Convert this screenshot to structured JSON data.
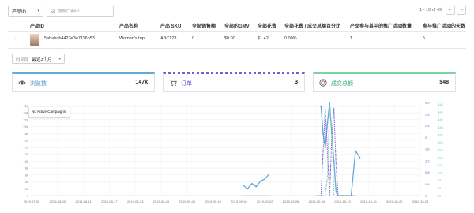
{
  "toolbar": {
    "select_label": "产品ID",
    "search_placeholder": "搜索产品ID",
    "pager_text": "1 - 10 of 49"
  },
  "table": {
    "columns": [
      "产品ID",
      "产品名称",
      "产品 SKU",
      "全部销售额",
      "全部的GMV",
      "全部花费",
      "全部花费 / 成交总额百分比",
      "产品参与其中的推广活动数量",
      "参与推广活动的天数"
    ],
    "row": [
      "5ababab4423e3e7116b53...",
      "Woman's top",
      "ABC123",
      "0",
      "$0.00",
      "$1.42",
      "0.00%",
      "1",
      "5"
    ]
  },
  "date_range": {
    "label": "时间段",
    "value": "最近3个月"
  },
  "cards": [
    {
      "label": "浏览数",
      "value": "147k",
      "color": "#67a9d4",
      "icon": "eye-icon"
    },
    {
      "label": "订单",
      "value": "3",
      "color": "#7b5bd6",
      "icon": "cart-icon"
    },
    {
      "label": "成交总额",
      "value": "$48",
      "color": "#79d3a7",
      "icon": "dollar-circle-icon"
    }
  ],
  "tooltip": "No Active Campaigns",
  "chart_data": {
    "type": "line",
    "x": [
      "2019-07-30",
      "2019-08-05",
      "2019-08-11",
      "2019-08-17",
      "2019-08-23",
      "2019-08-29",
      "2019-09-04",
      "2019-09-10",
      "2019-09-16",
      "2019-09-22",
      "2019-09-28",
      "2019-10-04",
      "2019-10-10",
      "2019-10-16",
      "2019-10-22",
      "2019-10-28"
    ],
    "left_axis": {
      "ticks": [
        "0",
        "2k",
        "4k",
        "6k",
        "8k",
        "10k",
        "12k",
        "14k",
        "16k",
        "18k",
        "20k",
        "22k",
        "24k",
        "26k"
      ],
      "max": 27000,
      "color": "#67a9d4"
    },
    "right_axis_orders": {
      "ticks": [
        "0",
        "0.4",
        "0.8",
        "1.2",
        "1.6",
        "2",
        "2.4",
        "2.8",
        "3.2"
      ],
      "max": 3.2,
      "color": "#7b5bd6"
    },
    "right_axis_gmv": {
      "ticks": [
        "$0",
        "$4",
        "$8",
        "$12",
        "$16",
        "$20",
        "$24",
        "$28",
        "$32",
        "$36",
        "$40",
        "$44",
        "$48"
      ],
      "max": 49,
      "color": "#79d3a7"
    },
    "series": [
      {
        "name": "浏览数",
        "axis": "left",
        "color": "#67a9d4",
        "points": [
          [
            49.0,
            3000
          ],
          [
            50.0,
            2000
          ],
          [
            51.0,
            3500
          ],
          [
            52.0,
            2600
          ],
          [
            53.0,
            4200
          ],
          [
            54.0,
            4800
          ],
          [
            55.0,
            6300
          ],
          [
            null,
            null
          ],
          [
            67.0,
            26000
          ],
          [
            67.5,
            18000
          ],
          [
            68.0,
            14000
          ],
          [
            68.5,
            21000
          ],
          [
            69.0,
            27000
          ],
          [
            69.5,
            18000
          ],
          [
            70.0,
            10000
          ],
          [
            70.5,
            1000
          ],
          [
            71.0,
            0
          ],
          [
            72.0,
            0
          ],
          [
            73.0,
            0
          ],
          [
            74.0,
            0
          ],
          [
            75.0,
            13000
          ],
          [
            76.0,
            11000
          ]
        ]
      },
      {
        "name": "订单",
        "axis": "right_orders",
        "color": "#7b5bd6",
        "dashed": true,
        "points": [
          [
            66.0,
            0
          ],
          [
            67.0,
            0
          ],
          [
            68.0,
            3.0
          ],
          [
            68.5,
            1.5
          ],
          [
            69.0,
            0
          ],
          [
            69.5,
            2.0
          ],
          [
            70.0,
            3.0
          ],
          [
            70.5,
            1.0
          ],
          [
            71.0,
            0
          ],
          [
            75.0,
            0
          ]
        ]
      },
      {
        "name": "成交总额",
        "axis": "right_gmv",
        "color": "#79d3a7",
        "dashed": true,
        "points": [
          [
            49.0,
            0
          ],
          [
            55.0,
            0
          ],
          [
            null,
            null
          ],
          [
            66.0,
            0
          ],
          [
            67.0,
            0
          ],
          [
            68.0,
            0
          ],
          [
            68.5,
            10
          ],
          [
            69.0,
            48
          ],
          [
            69.5,
            35
          ],
          [
            70.0,
            0
          ],
          [
            71.0,
            0
          ],
          [
            75.0,
            0
          ]
        ]
      }
    ]
  }
}
